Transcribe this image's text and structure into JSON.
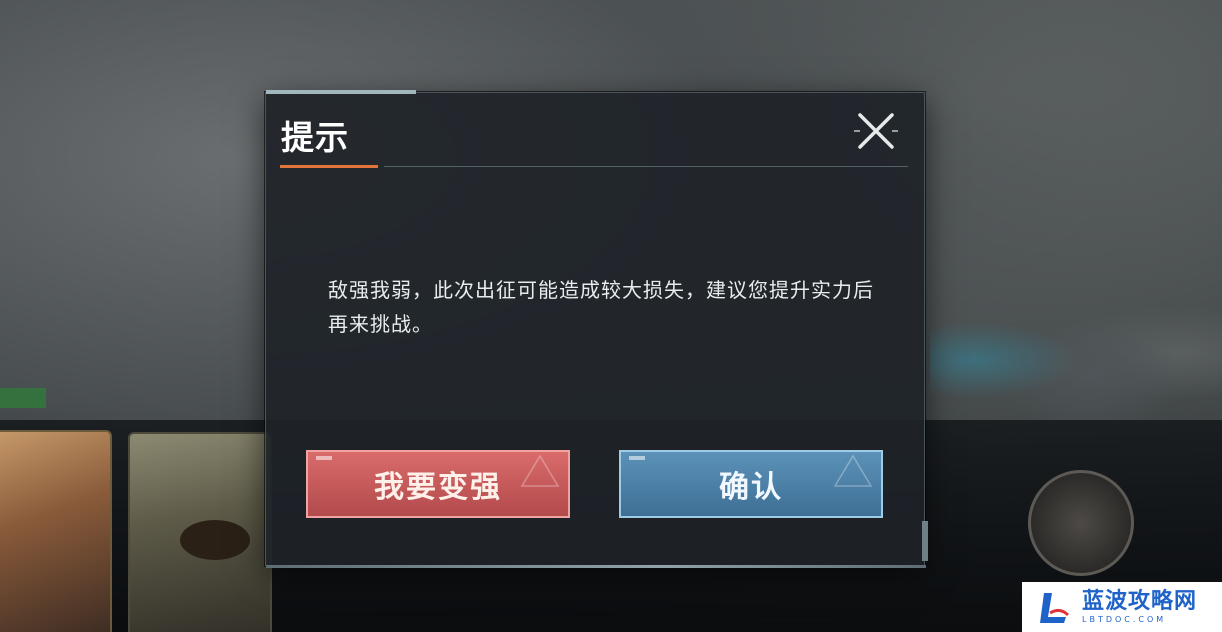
{
  "dialog": {
    "title": "提示",
    "message": "敌强我弱，此次出征可能造成较大损失，建议您提升实力后再来挑战。",
    "close_icon": "close-icon",
    "buttons": {
      "strengthen_label": "我要变强",
      "confirm_label": "确认"
    },
    "colors": {
      "strengthen_button": "#c85a5c",
      "confirm_button": "#4c80a8",
      "title_accent": "#e0743a"
    }
  },
  "watermark": {
    "title": "蓝波攻略网",
    "subtitle": "LBTDOC.COM",
    "color": "#1f63c9"
  }
}
